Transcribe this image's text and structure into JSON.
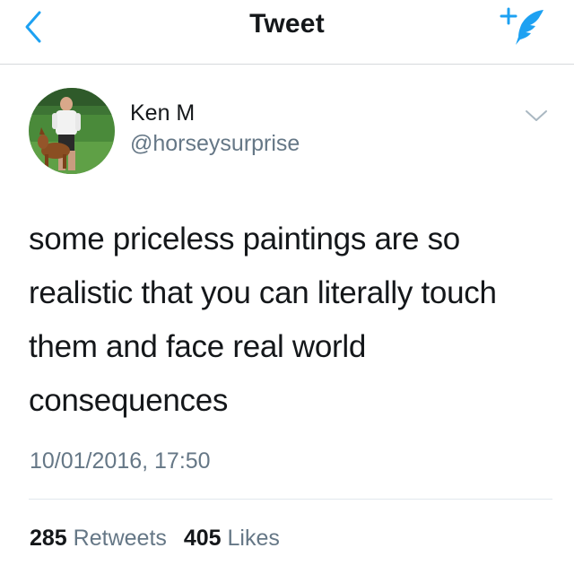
{
  "header": {
    "title": "Tweet",
    "back_icon": "chevron-left-icon",
    "compose_icon": "compose-quill-icon",
    "accent_color": "#1da1f2"
  },
  "tweet": {
    "author": {
      "name": "Ken M",
      "handle": "@horseysurprise",
      "avatar": "profile-photo-man-with-dog"
    },
    "text": "some priceless paintings are so realistic that you can literally touch them and face real world consequences",
    "timestamp": "10/01/2016, 17:50",
    "stats": {
      "retweets_count": "285",
      "retweets_label": "Retweets",
      "likes_count": "405",
      "likes_label": "Likes"
    }
  },
  "colors": {
    "text_primary": "#14171a",
    "text_secondary": "#657786",
    "divider": "#e1e8ed"
  }
}
